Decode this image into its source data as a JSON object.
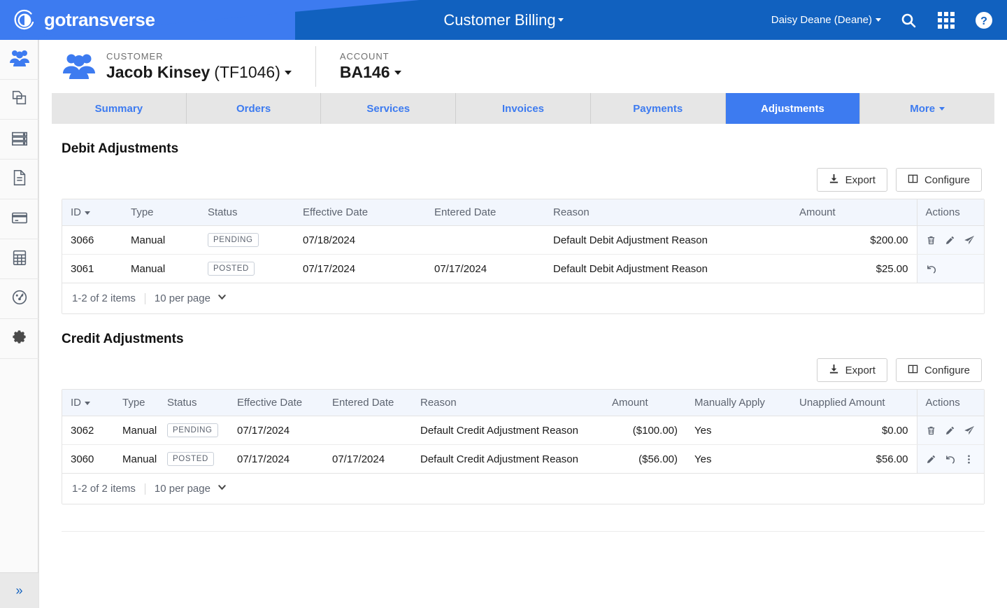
{
  "topbar": {
    "brand_name": "gotransverse",
    "brand_logo_icon": "gotransverse-circle-logo",
    "app_title": "Customer Billing",
    "app_title_caret_icon": "caret-down-icon",
    "user_menu": "Daisy Deane (Deane)",
    "user_caret_icon": "caret-down-icon",
    "search_icon": "search-icon",
    "apps_icon": "app-grid-icon",
    "help_icon": "help-circle-icon",
    "bg_color": "#1161bf",
    "accent_color": "#3d7bf0"
  },
  "rail": {
    "items": [
      {
        "icon": "customers-people-icon",
        "active": true
      },
      {
        "icon": "products-copy-icon",
        "active": false
      },
      {
        "icon": "servers-stack-icon",
        "active": false
      },
      {
        "icon": "document-icon",
        "active": false
      },
      {
        "icon": "credit-card-icon",
        "active": false
      },
      {
        "icon": "calculator-icon",
        "active": false
      },
      {
        "icon": "dashboard-gauge-icon",
        "active": false
      },
      {
        "icon": "settings-gear-icon",
        "active": false
      }
    ],
    "expand_icon": "double-chevron-right-icon",
    "expand_label": "»"
  },
  "context": {
    "avatar_icon": "customer-group-icon",
    "customer_label": "CUSTOMER",
    "customer_name": "Jacob Kinsey",
    "customer_code": "(TF1046)",
    "customer_caret_icon": "caret-down-icon",
    "account_label": "ACCOUNT",
    "account_value": "BA146",
    "account_caret_icon": "caret-down-icon"
  },
  "tabs": [
    {
      "label": "Summary",
      "active": false
    },
    {
      "label": "Orders",
      "active": false
    },
    {
      "label": "Services",
      "active": false
    },
    {
      "label": "Invoices",
      "active": false
    },
    {
      "label": "Payments",
      "active": false
    },
    {
      "label": "Adjustments",
      "active": true
    },
    {
      "label": "More",
      "active": false,
      "has_caret": true
    }
  ],
  "debit_section": {
    "title": "Debit Adjustments",
    "export_label": "Export",
    "export_icon": "download-icon",
    "configure_label": "Configure",
    "configure_icon": "columns-icon",
    "columns": [
      "ID",
      "Type",
      "Status",
      "Effective Date",
      "Entered Date",
      "Reason",
      "Amount",
      "Actions"
    ],
    "sort_column": "ID",
    "sort_caret_icon": "sort-desc-caret-icon",
    "rows": [
      {
        "id": "3066",
        "type": "Manual",
        "status": "PENDING",
        "effective_date": "07/18/2024",
        "entered_date": "",
        "reason": "Default Debit Adjustment Reason",
        "amount": "$200.00",
        "actions": [
          "trash-icon",
          "pencil-icon",
          "send-icon"
        ]
      },
      {
        "id": "3061",
        "type": "Manual",
        "status": "POSTED",
        "effective_date": "07/17/2024",
        "entered_date": "07/17/2024",
        "reason": "Default Debit Adjustment Reason",
        "amount": "$25.00",
        "actions": [
          "undo-icon"
        ]
      }
    ],
    "pager": {
      "items_text": "1-2 of 2 items",
      "per_page": "10 per page",
      "chevron_icon": "chevron-down-icon"
    }
  },
  "credit_section": {
    "title": "Credit Adjustments",
    "export_label": "Export",
    "export_icon": "download-icon",
    "configure_label": "Configure",
    "configure_icon": "columns-icon",
    "columns": [
      "ID",
      "Type",
      "Status",
      "Effective Date",
      "Entered Date",
      "Reason",
      "Amount",
      "Manually Apply",
      "Unapplied Amount",
      "Actions"
    ],
    "sort_column": "ID",
    "sort_caret_icon": "sort-desc-caret-icon",
    "rows": [
      {
        "id": "3062",
        "type": "Manual",
        "status": "PENDING",
        "effective_date": "07/17/2024",
        "entered_date": "",
        "reason": "Default Credit Adjustment Reason",
        "amount": "($100.00)",
        "manually_apply": "Yes",
        "unapplied_amount": "$0.00",
        "actions": [
          "trash-icon",
          "pencil-icon",
          "send-icon"
        ]
      },
      {
        "id": "3060",
        "type": "Manual",
        "status": "POSTED",
        "effective_date": "07/17/2024",
        "entered_date": "07/17/2024",
        "reason": "Default Credit Adjustment Reason",
        "amount": "($56.00)",
        "manually_apply": "Yes",
        "unapplied_amount": "$56.00",
        "actions": [
          "pencil-icon",
          "undo-icon",
          "more-vertical-icon"
        ]
      }
    ],
    "pager": {
      "items_text": "1-2 of 2 items",
      "per_page": "10 per page",
      "chevron_icon": "chevron-down-icon"
    }
  }
}
